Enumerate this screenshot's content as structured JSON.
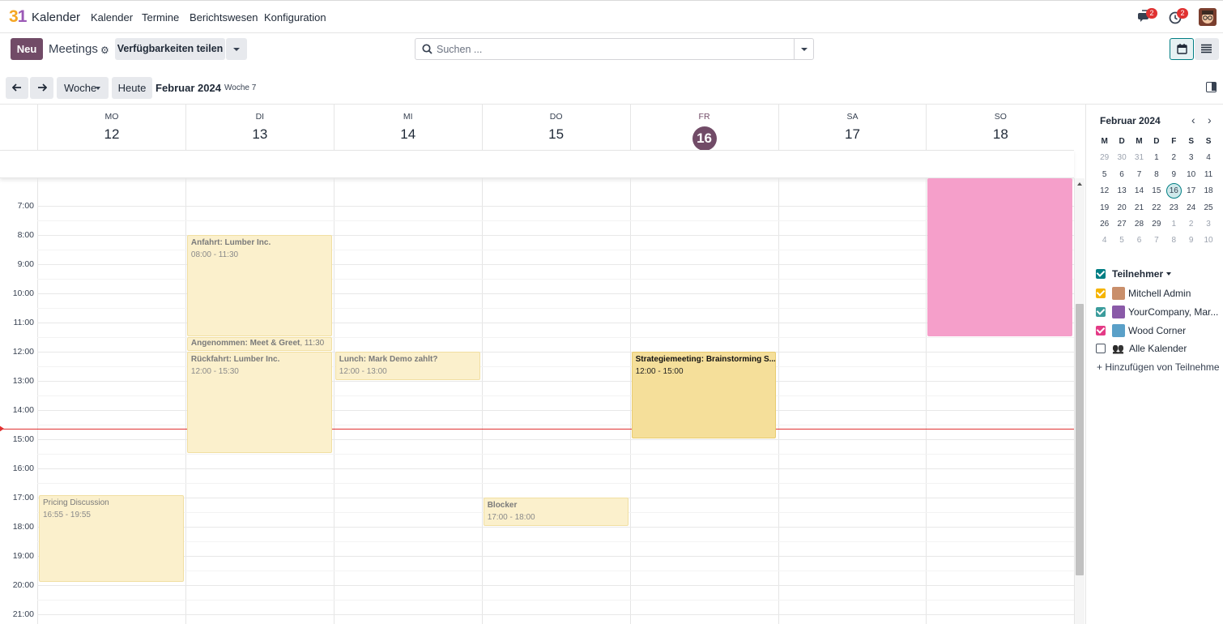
{
  "app": {
    "name": "Kalender",
    "menus": [
      "Kalender",
      "Termine",
      "Berichtswesen",
      "Konfiguration"
    ],
    "notif_msgs": "2",
    "notif_activities": "2"
  },
  "control": {
    "new_label": "Neu",
    "title": "Meetings",
    "share_label": "Verfügbarkeiten teilen",
    "search_placeholder": "Suchen ..."
  },
  "nav": {
    "scale": "Woche",
    "today": "Heute",
    "period": "Februar 2024",
    "week": "Woche 7"
  },
  "days": [
    {
      "name": "MO",
      "num": "12"
    },
    {
      "name": "DI",
      "num": "13"
    },
    {
      "name": "MI",
      "num": "14"
    },
    {
      "name": "DO",
      "num": "15"
    },
    {
      "name": "FR",
      "num": "16",
      "today": true
    },
    {
      "name": "SA",
      "num": "17"
    },
    {
      "name": "SO",
      "num": "18"
    }
  ],
  "hours": [
    "7:00",
    "8:00",
    "9:00",
    "10:00",
    "11:00",
    "12:00",
    "13:00",
    "14:00",
    "15:00",
    "16:00",
    "17:00",
    "18:00",
    "19:00",
    "20:00",
    "21:00"
  ],
  "events": [
    {
      "day": 1,
      "start": 8.0,
      "end": 11.5,
      "title": "Anfahrt: Lumber Inc.",
      "time": "08:00 - 11:30"
    },
    {
      "day": 1,
      "start": 11.5,
      "end": 12.0,
      "title": "Angenommen: Meet & Greet",
      "suffix": ", 11:30",
      "time": ""
    },
    {
      "day": 1,
      "start": 12.0,
      "end": 15.5,
      "title": "Rückfahrt: Lumber Inc.",
      "time": "12:00 - 15:30"
    },
    {
      "day": 2,
      "start": 12.0,
      "end": 13.0,
      "title": "Lunch: Mark Demo zahlt?",
      "time": "12:00 - 13:00"
    },
    {
      "day": 4,
      "start": 12.0,
      "end": 15.0,
      "title": "Strategiemeeting: Brainstorming S...",
      "time": "12:00 - 15:00",
      "style": "strong"
    },
    {
      "day": 0,
      "start": 16.92,
      "end": 19.92,
      "title": "Pricing Discussion",
      "time": "16:55 - 19:55",
      "style": "light"
    },
    {
      "day": 3,
      "start": 17.0,
      "end": 18.0,
      "title": "Blocker",
      "time": "17:00 - 18:00"
    },
    {
      "day": 6,
      "start": 6.0,
      "end": 11.5,
      "title": "",
      "time": "",
      "style": "pink"
    }
  ],
  "mini": {
    "title": "Februar 2024",
    "headers": [
      "M",
      "D",
      "M",
      "D",
      "F",
      "S",
      "S"
    ],
    "weeks": [
      [
        "29",
        "30",
        "31",
        "1",
        "2",
        "3",
        "4"
      ],
      [
        "5",
        "6",
        "7",
        "8",
        "9",
        "10",
        "11"
      ],
      [
        "12",
        "13",
        "14",
        "15",
        "16",
        "17",
        "18"
      ],
      [
        "19",
        "20",
        "21",
        "22",
        "23",
        "24",
        "25"
      ],
      [
        "26",
        "27",
        "28",
        "29",
        "1",
        "2",
        "3"
      ],
      [
        "4",
        "5",
        "6",
        "7",
        "8",
        "9",
        "10"
      ]
    ]
  },
  "attendees": {
    "header": "Teilnehmer",
    "items": [
      {
        "name": "Mitchell Admin",
        "color": "#f5b400",
        "checked": true
      },
      {
        "name": "YourCompany, Mar...",
        "color": "#3b9c9c",
        "checked": true
      },
      {
        "name": "Wood Corner",
        "color": "#e43a86",
        "checked": true
      },
      {
        "name": "Alle Kalender",
        "checked": false
      }
    ],
    "add": "+ Hinzufügen von Teilnehme"
  }
}
